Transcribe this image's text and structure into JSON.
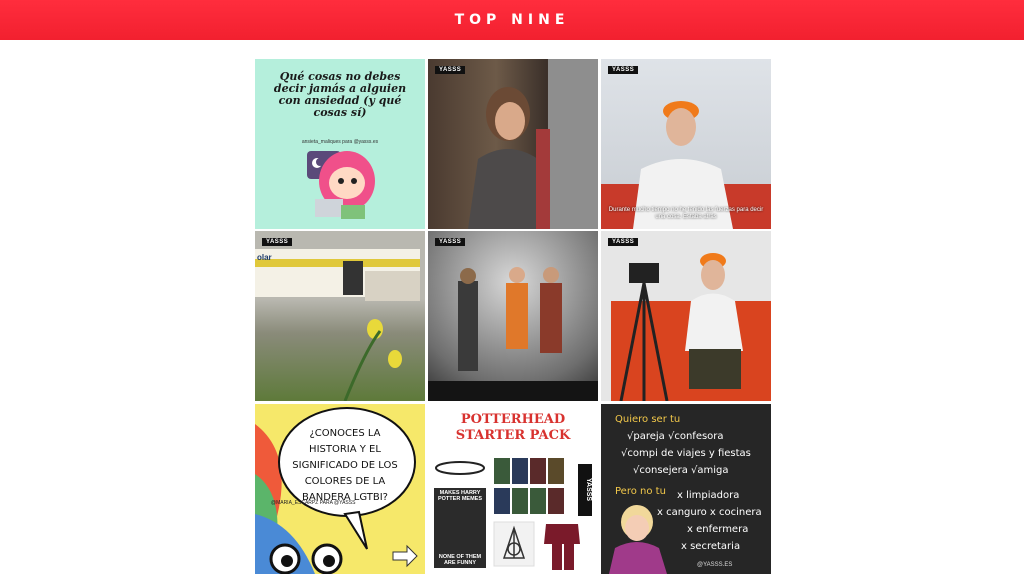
{
  "header": {
    "title": "TOP NINE"
  },
  "tiles": [
    {
      "text": "Qué cosas no debes decir jamás a alguien con ansiedad (y qué cosas sí)",
      "sub": "ansieta_maliques para @yasss.es"
    },
    {
      "badge": "YASSS"
    },
    {
      "badge": "YASSS",
      "caption": "Durante mucho tiempo no he tenido las fuerzas para decir una cosa. Estaba atrás"
    },
    {
      "badge": "YASSS",
      "bus_text": "olar"
    },
    {
      "badge": "YASSS"
    },
    {
      "badge": "YASSS"
    },
    {
      "text": "¿CONOCES LA HISTORIA Y EL SIGNIFICADO DE LOS COLORES DE LA BANDERA LGTBI?",
      "sub": "@MARIA_ESCARPZ PARA @YASSS"
    },
    {
      "title_line1": "POTTERHEAD",
      "title_line2": "STARTER PACK",
      "side": "YASSS",
      "poster_top": "MAKES HARRY POTTER MEMES",
      "poster_bottom": "NONE OF THEM ARE FUNNY"
    },
    {
      "line1": "Quiero ser tu",
      "line2": "√pareja √confesora",
      "line3": "√compi de viajes y fiestas",
      "line4": "√consejera √amiga",
      "line5": "Pero no tu",
      "line6": "x limpiadora",
      "line7": "x canguro x cocinera",
      "line8": "x enfermera",
      "line9": "x secretaria",
      "credit": "@YASSS.ES"
    }
  ]
}
